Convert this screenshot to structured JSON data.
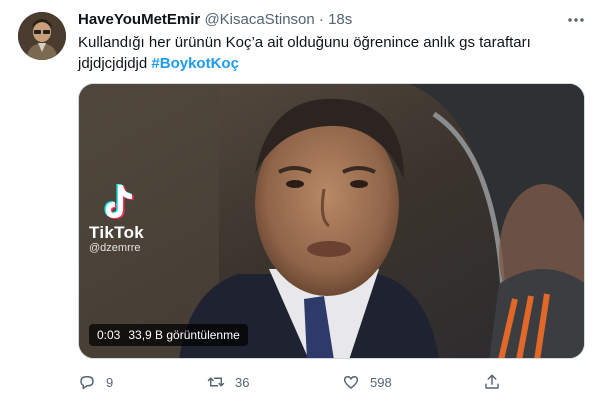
{
  "tweet": {
    "author_name": "HaveYouMetEmir",
    "author_handle": "@KisacaStinson",
    "separator": "·",
    "time": "18s",
    "text": "Kullandığı her ürünün Koç’a ait olduğunu öğrenince anlık gs taraftarı jdjdjcjdjdjd",
    "hashtag": "#BoykotKoç"
  },
  "video": {
    "watermark_brand": "TikTok",
    "watermark_user": "@dzemrre",
    "duration": "0:03",
    "views": "33,9 B görüntülenme"
  },
  "actions": {
    "replies": "9",
    "retweets": "36",
    "likes": "598"
  },
  "icons": {
    "more": "more-icon",
    "reply": "reply-icon",
    "retweet": "retweet-icon",
    "like": "like-icon",
    "share": "share-icon"
  },
  "colors": {
    "link": "#1d9bf0",
    "muted": "#536471",
    "text": "#0f1419"
  }
}
